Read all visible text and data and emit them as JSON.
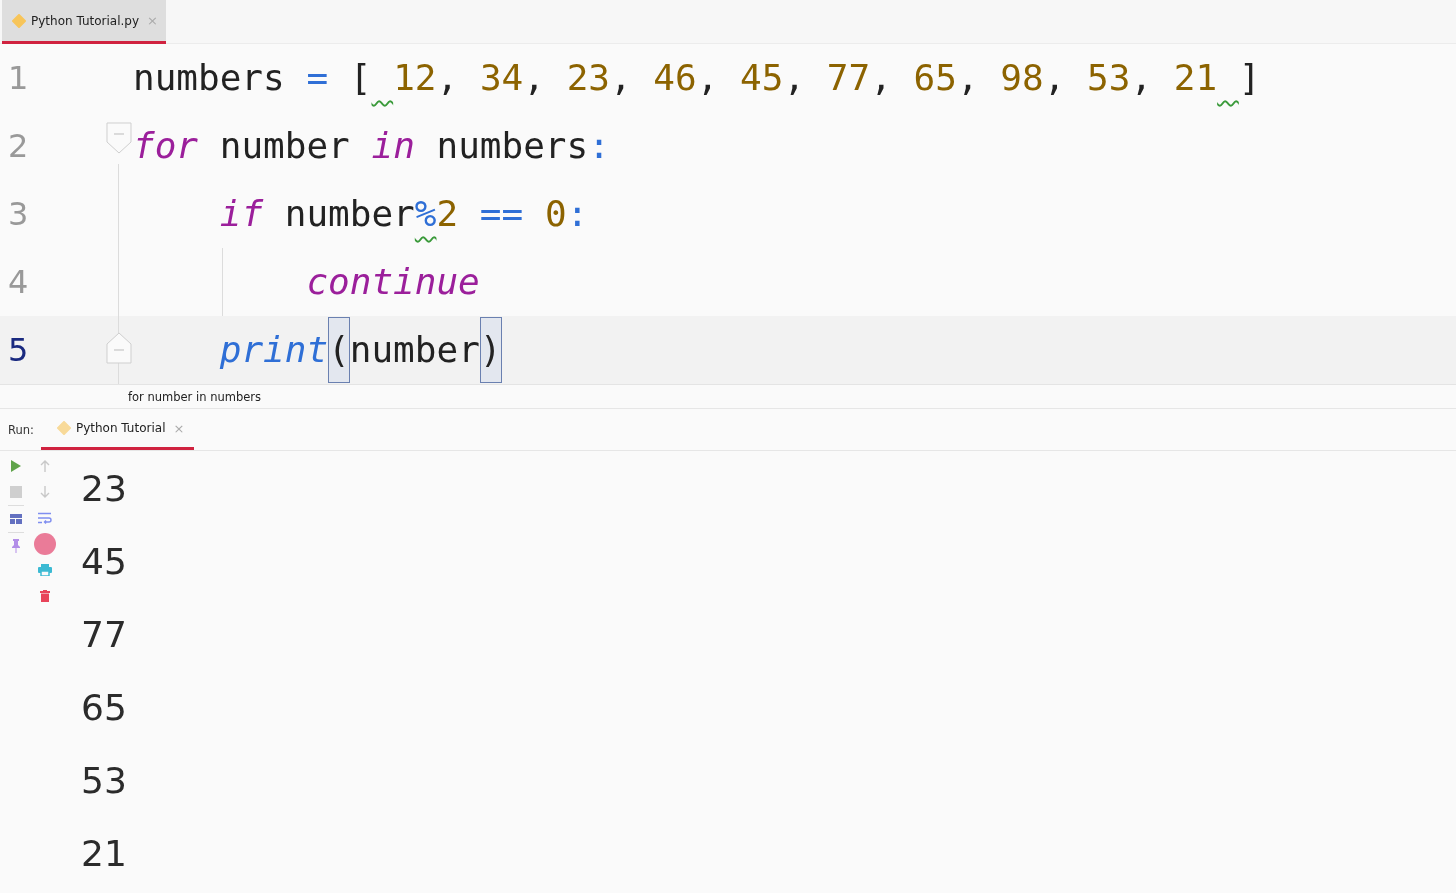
{
  "editor_tab": {
    "label": "Python Tutorial.py",
    "close": "×",
    "selected": true
  },
  "code_lines": [
    {
      "number": "1",
      "current": false,
      "fold_open": false,
      "fold_close": false,
      "tokens": [
        {
          "text": "numbers",
          "kind": "plain",
          "warning": false
        },
        {
          "text": " =",
          "kind": "operator",
          "warning": false
        },
        {
          "text": " [",
          "kind": "plain",
          "warning": false
        },
        {
          "text": " 12",
          "kind": "number",
          "warning": true
        },
        {
          "text": ",",
          "kind": "plain",
          "warning": false
        },
        {
          "text": " 34",
          "kind": "number",
          "warning": false
        },
        {
          "text": ",",
          "kind": "plain",
          "warning": false
        },
        {
          "text": " 23",
          "kind": "number",
          "warning": false
        },
        {
          "text": ",",
          "kind": "plain",
          "warning": false
        },
        {
          "text": " 46",
          "kind": "number",
          "warning": false
        },
        {
          "text": ",",
          "kind": "plain",
          "warning": false
        },
        {
          "text": " 45",
          "kind": "number",
          "warning": false
        },
        {
          "text": ",",
          "kind": "plain",
          "warning": false
        },
        {
          "text": " 77",
          "kind": "number",
          "warning": false
        },
        {
          "text": ",",
          "kind": "plain",
          "warning": false
        },
        {
          "text": " 65",
          "kind": "number",
          "warning": false
        },
        {
          "text": ",",
          "kind": "plain",
          "warning": false
        },
        {
          "text": " 98",
          "kind": "number",
          "warning": false
        },
        {
          "text": ",",
          "kind": "plain",
          "warning": false
        },
        {
          "text": " 53",
          "kind": "number",
          "warning": false
        },
        {
          "text": ",",
          "kind": "plain",
          "warning": false
        },
        {
          "text": " 21",
          "kind": "number",
          "warning": false
        },
        {
          "text": " ]",
          "kind": "plain",
          "warning": true
        }
      ]
    },
    {
      "number": "2",
      "current": false,
      "fold_open": true,
      "fold_close": false,
      "tokens": [
        {
          "text": "for",
          "kind": "keyword",
          "warning": false
        },
        {
          "text": " number",
          "kind": "plain",
          "warning": false
        },
        {
          "text": " in",
          "kind": "keyword",
          "warning": false
        },
        {
          "text": " numbers",
          "kind": "plain",
          "warning": false
        },
        {
          "text": ":",
          "kind": "operator",
          "warning": false
        }
      ]
    },
    {
      "number": "3",
      "current": false,
      "fold_open": false,
      "fold_close": false,
      "tokens": [
        {
          "text": "    if",
          "kind": "keyword",
          "warning": false
        },
        {
          "text": " number",
          "kind": "plain",
          "warning": false
        },
        {
          "text": "%",
          "kind": "operator",
          "warning": true
        },
        {
          "text": "2",
          "kind": "number",
          "warning": false
        },
        {
          "text": " ==",
          "kind": "operator",
          "warning": false
        },
        {
          "text": " 0",
          "kind": "number",
          "warning": false
        },
        {
          "text": ":",
          "kind": "operator",
          "warning": false
        }
      ]
    },
    {
      "number": "4",
      "current": false,
      "fold_open": false,
      "fold_close": false,
      "tokens": [
        {
          "text": "        continue",
          "kind": "keyword",
          "warning": false
        }
      ]
    },
    {
      "number": "5",
      "current": true,
      "fold_open": false,
      "fold_close": true,
      "tokens": [
        {
          "text": "    print",
          "kind": "builtin",
          "warning": false
        },
        {
          "text": "(",
          "kind": "paren-match",
          "warning": false
        },
        {
          "text": "number",
          "kind": "plain",
          "warning": false
        },
        {
          "text": ")",
          "kind": "paren-match",
          "warning": false
        }
      ]
    }
  ],
  "breadcrumb": "for number in numbers",
  "run_panel": {
    "label": "Run:",
    "tab": {
      "label": "Python Tutorial",
      "close": "×",
      "selected": true
    }
  },
  "output": [
    "23",
    "45",
    "77",
    "65",
    "53",
    "21"
  ]
}
